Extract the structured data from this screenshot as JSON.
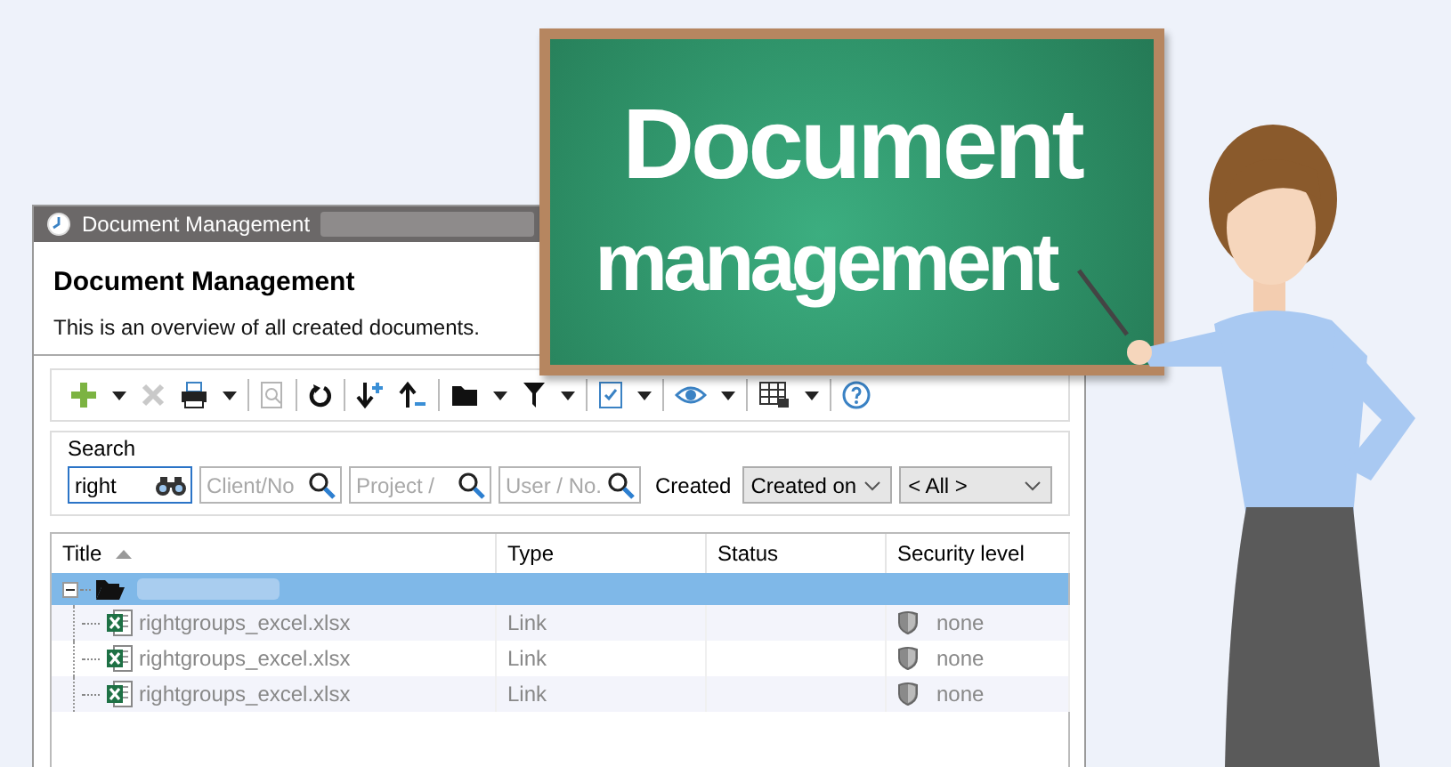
{
  "window": {
    "title": "Document Management"
  },
  "header": {
    "title": "Document Management",
    "subtitle": "This is an overview of all created documents."
  },
  "toolbar": {
    "groups": [
      [
        {
          "kind": "add",
          "disabled": false
        },
        {
          "kind": "caret",
          "disabled": false
        },
        {
          "kind": "delete",
          "disabled": true
        },
        {
          "kind": "print",
          "disabled": false
        },
        {
          "kind": "caret",
          "disabled": false
        }
      ],
      [
        {
          "kind": "preview",
          "disabled": true
        }
      ],
      [
        {
          "kind": "refresh",
          "disabled": false
        }
      ],
      [
        {
          "kind": "sort-down",
          "disabled": false
        },
        {
          "kind": "sort-up",
          "disabled": false
        }
      ],
      [
        {
          "kind": "folder",
          "disabled": false
        },
        {
          "kind": "caret",
          "disabled": false
        },
        {
          "kind": "filter",
          "disabled": false
        },
        {
          "kind": "caret",
          "disabled": false
        }
      ],
      [
        {
          "kind": "checklist",
          "disabled": false
        },
        {
          "kind": "caret",
          "disabled": false
        }
      ],
      [
        {
          "kind": "eye",
          "disabled": false
        },
        {
          "kind": "caret",
          "disabled": false
        }
      ],
      [
        {
          "kind": "grid",
          "disabled": false
        },
        {
          "kind": "caret",
          "disabled": false
        }
      ],
      [
        {
          "kind": "help",
          "disabled": false
        }
      ]
    ]
  },
  "search": {
    "label": "Search",
    "fields": [
      {
        "kind": "binoculars",
        "value": "right",
        "focused": true
      },
      {
        "kind": "search",
        "placeholder": "Client/No",
        "focused": false
      },
      {
        "kind": "search",
        "placeholder": "Project /",
        "focused": false
      },
      {
        "kind": "search",
        "placeholder": "User / No.",
        "focused": false
      }
    ],
    "created_label": "Created",
    "dropdowns": [
      {
        "value": "Created on"
      },
      {
        "value": "< All >"
      }
    ]
  },
  "table": {
    "columns": [
      {
        "label": "Title",
        "sorted_ascending": true
      },
      {
        "label": "Type"
      },
      {
        "label": "Status"
      },
      {
        "label": "Security level"
      }
    ],
    "rows": [
      {
        "kind": "folder",
        "selected": true,
        "expanded": true,
        "children": [
          {
            "title": "rightgroups_excel.xlsx",
            "type": "Link",
            "security": "none",
            "selected": false
          },
          {
            "title": "rightgroups_excel.xlsx",
            "type": "Link",
            "security": "none",
            "selected": false
          },
          {
            "title": "rightgroups_excel.xlsx",
            "type": "Link",
            "security": "none",
            "selected": false
          }
        ]
      }
    ]
  },
  "board": {
    "lines": [
      "Document",
      "management"
    ]
  }
}
